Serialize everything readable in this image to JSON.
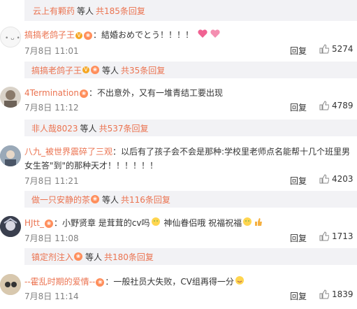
{
  "reply_bars": [
    {
      "user": "云上有颗药",
      "deng": "等人",
      "count": "共185条回复"
    },
    {
      "user": "搞搞老鸽子王",
      "deng": "等人",
      "count": "共35条回复"
    },
    {
      "user": "非人哉8023",
      "deng": "等人",
      "count": "共537条回复"
    },
    {
      "user": "做一只安静的茶",
      "deng": "等人",
      "count": "共116条回复"
    },
    {
      "user": "镇定剂注入",
      "deng": "等人",
      "count": "共180条回复"
    }
  ],
  "comments": [
    {
      "user": "搞搞老鸽子王",
      "text": "：結婚おめでとう！！！！",
      "date": "7月8日 11:01",
      "reply": "回复",
      "likes": "5274"
    },
    {
      "user": "4Termination",
      "text": "：不出意外，又有一堆青结工要出现",
      "date": "7月8日 11:12",
      "reply": "回复",
      "likes": "4789"
    },
    {
      "user": "八九_被世界震碎了三观",
      "text": "：以后有了孩子会不会是那种:学校里老师点名能帮十几个班里男",
      "text2": "女生答\"到\"的那种天才！！！！！！",
      "date": "7月8日 11:21",
      "reply": "回复",
      "likes": "4203"
    },
    {
      "user": "HJtt_",
      "text": "：小野贤章 是茸茸的cv吗",
      "text_b": " 神仙眷侣哦 祝福祝福",
      "date": "7月8日 11:08",
      "reply": "回复",
      "likes": "1713"
    },
    {
      "user": "--霍乱时期的爱情--",
      "text": "：一般社员大失败，CV组再得一分",
      "date": "7月8日 11:14",
      "reply": "回复",
      "likes": "1839"
    }
  ],
  "colors": {
    "accent": "#eb7350",
    "meta": "#808080",
    "reply_bg": "#f2f2f5"
  }
}
